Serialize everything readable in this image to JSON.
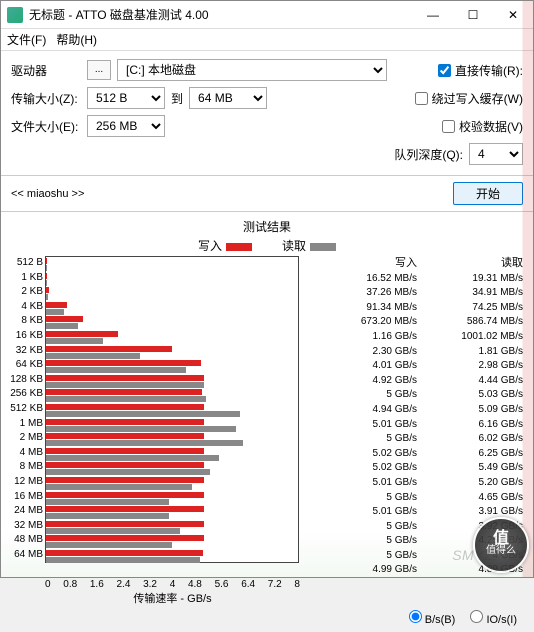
{
  "title": "无标题 - ATTO 磁盘基准测试 4.00",
  "menu": {
    "file": "文件(F)",
    "help": "帮助(H)"
  },
  "labels": {
    "drive": "驱动器",
    "driveBtn": "...",
    "transferSize": "传输大小(Z):",
    "to": "到",
    "fileSize": "文件大小(E):",
    "directIO": "直接传输(R):",
    "bypassCache": "绕过写入缓存(W)",
    "verify": "校验数据(V)",
    "queueDepth": "队列深度(Q):",
    "start": "开始",
    "resultsTitle": "测试结果",
    "writeLegend": "写入",
    "readLegend": "读取",
    "xAxisLabel": "传输速率 - GB/s",
    "bpsRadio": "B/s(B)",
    "iopsRadio": "IO/s(I)",
    "writeCol": "写入",
    "readCol": "读取"
  },
  "values": {
    "driveSelect": "[C:] 本地磁盘",
    "tsizeFrom": "512 B",
    "tsizeTo": "64 MB",
    "fileSizeSel": "256 MB",
    "queueDepthSel": "4",
    "pathText": "<< miaoshu >>"
  },
  "watermark": "SMYZ.NET",
  "stamp": {
    "l1": "值",
    "l2": "值得么"
  },
  "chart_data": {
    "type": "bar",
    "title": "测试结果",
    "xlabel": "传输速率 - GB/s",
    "ylabel": "",
    "xlim": [
      0,
      8
    ],
    "xticks": [
      0,
      0.8,
      1.6,
      2.4,
      3.2,
      4,
      4.8,
      5.6,
      6.4,
      7.2,
      8
    ],
    "categories": [
      "512 B",
      "1 KB",
      "2 KB",
      "4 KB",
      "8 KB",
      "16 KB",
      "32 KB",
      "64 KB",
      "128 KB",
      "256 KB",
      "512 KB",
      "1 MB",
      "2 MB",
      "4 MB",
      "8 MB",
      "12 MB",
      "16 MB",
      "24 MB",
      "32 MB",
      "48 MB",
      "64 MB"
    ],
    "series": [
      {
        "name": "写入",
        "values_label": [
          "16.52 MB/s",
          "37.26 MB/s",
          "91.34 MB/s",
          "673.20 MB/s",
          "1.16 GB/s",
          "2.30 GB/s",
          "4.01 GB/s",
          "4.92 GB/s",
          "5 GB/s",
          "4.94 GB/s",
          "5.01 GB/s",
          "5 GB/s",
          "5.02 GB/s",
          "5.02 GB/s",
          "5.01 GB/s",
          "5 GB/s",
          "5.01 GB/s",
          "5 GB/s",
          "5 GB/s",
          "5 GB/s",
          "4.99 GB/s"
        ],
        "values": [
          0.01652,
          0.03726,
          0.09134,
          0.6732,
          1.16,
          2.3,
          4.01,
          4.92,
          5.0,
          4.94,
          5.01,
          5.0,
          5.02,
          5.02,
          5.01,
          5.0,
          5.01,
          5.0,
          5.0,
          5.0,
          4.99
        ]
      },
      {
        "name": "读取",
        "values_label": [
          "19.31 MB/s",
          "34.91 MB/s",
          "74.25 MB/s",
          "586.74 MB/s",
          "1001.02 MB/s",
          "1.81 GB/s",
          "2.98 GB/s",
          "4.44 GB/s",
          "5.03 GB/s",
          "5.09 GB/s",
          "6.16 GB/s",
          "6.02 GB/s",
          "6.25 GB/s",
          "5.49 GB/s",
          "5.20 GB/s",
          "4.65 GB/s",
          "3.91 GB/s",
          "3.92 GB/s",
          "4.25 GB/s",
          "4 GB/s",
          "4.89 GB/s"
        ],
        "values": [
          0.01931,
          0.03491,
          0.07425,
          0.58674,
          1.00102,
          1.81,
          2.98,
          4.44,
          5.03,
          5.09,
          6.16,
          6.02,
          6.25,
          5.49,
          5.2,
          4.65,
          3.91,
          3.92,
          4.25,
          4.0,
          4.89
        ]
      }
    ]
  }
}
